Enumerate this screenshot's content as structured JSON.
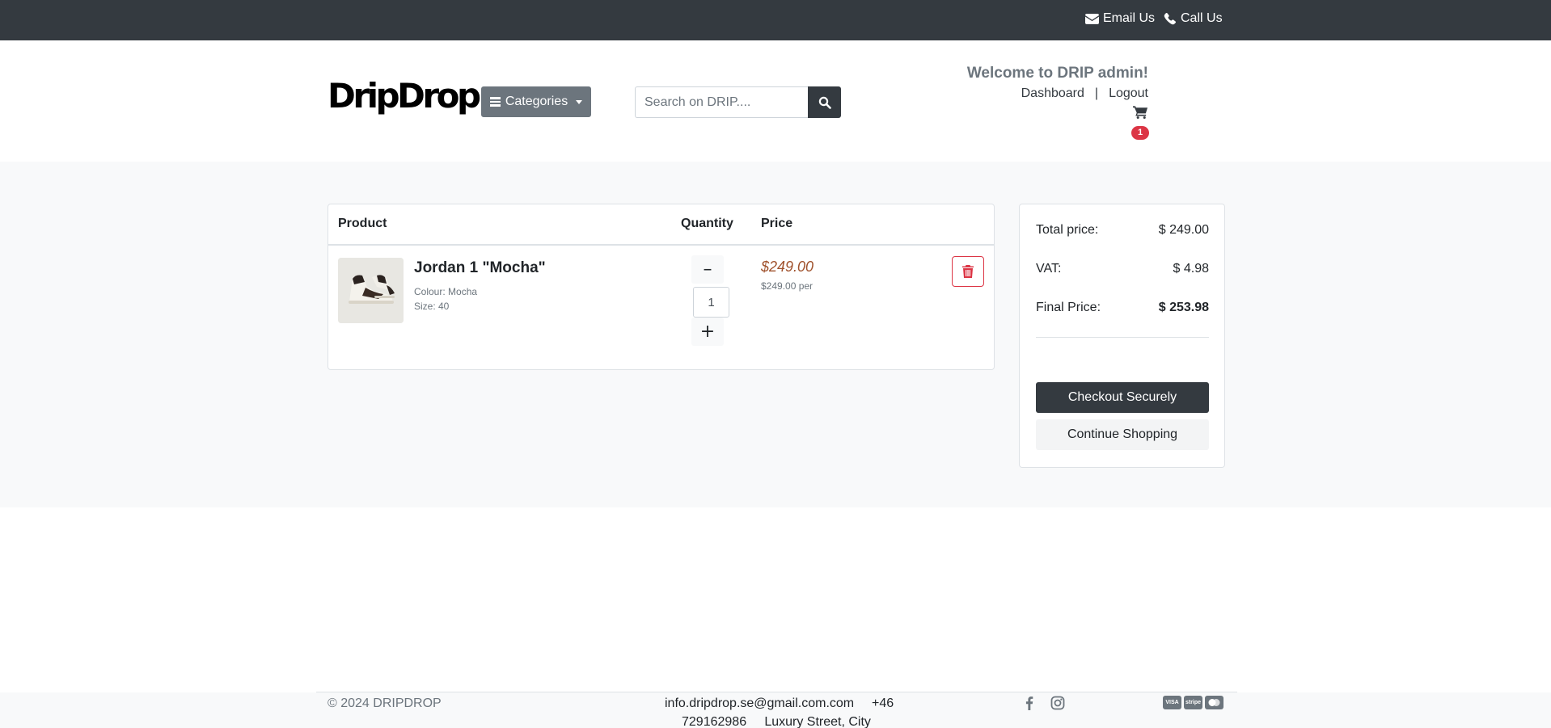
{
  "topbar": {
    "email_label": "Email Us",
    "call_label": "Call Us"
  },
  "header": {
    "logo": "DripDrop",
    "categories_label": "Categories",
    "search_placeholder": "Search on DRIP....",
    "welcome": "Welcome to DRIP admin!",
    "dashboard_link": "Dashboard",
    "separator": "|",
    "logout_link": "Logout",
    "cart_count": "1"
  },
  "cart": {
    "headers": {
      "product": "Product",
      "quantity": "Quantity",
      "price": "Price"
    },
    "items": [
      {
        "name": "Jordan 1 \"Mocha\"",
        "colour": "Colour: Mocha",
        "size": "Size: 40",
        "quantity": "1",
        "price": "$249.00",
        "price_per": "$249.00 per",
        "minus_symbol": "–",
        "plus_symbol": "+"
      }
    ]
  },
  "summary": {
    "total_label": "Total price:",
    "total_value": "$ 249.00",
    "vat_label": "VAT:",
    "vat_value": "$ 4.98",
    "final_label": "Final Price:",
    "final_value": "$ 253.98",
    "checkout_label": "Checkout Securely",
    "continue_label": "Continue Shopping"
  },
  "footer": {
    "copyright": "© 2024 DRIPDROP",
    "email": "info.dripdrop.se@gmail.com.com",
    "phone_prefix": "+46",
    "phone_number": "729162986",
    "address": "Luxury Street, City",
    "social": [
      "facebook-icon",
      "instagram-icon"
    ],
    "payment_methods": [
      "VISA",
      "stripe",
      "mastercard"
    ]
  },
  "colors": {
    "topbar_bg": "#343a40",
    "accent_dark": "#343a40",
    "badge_red": "#dc3545",
    "price_brown": "#a0522d",
    "main_bg": "#f8f9fa"
  }
}
